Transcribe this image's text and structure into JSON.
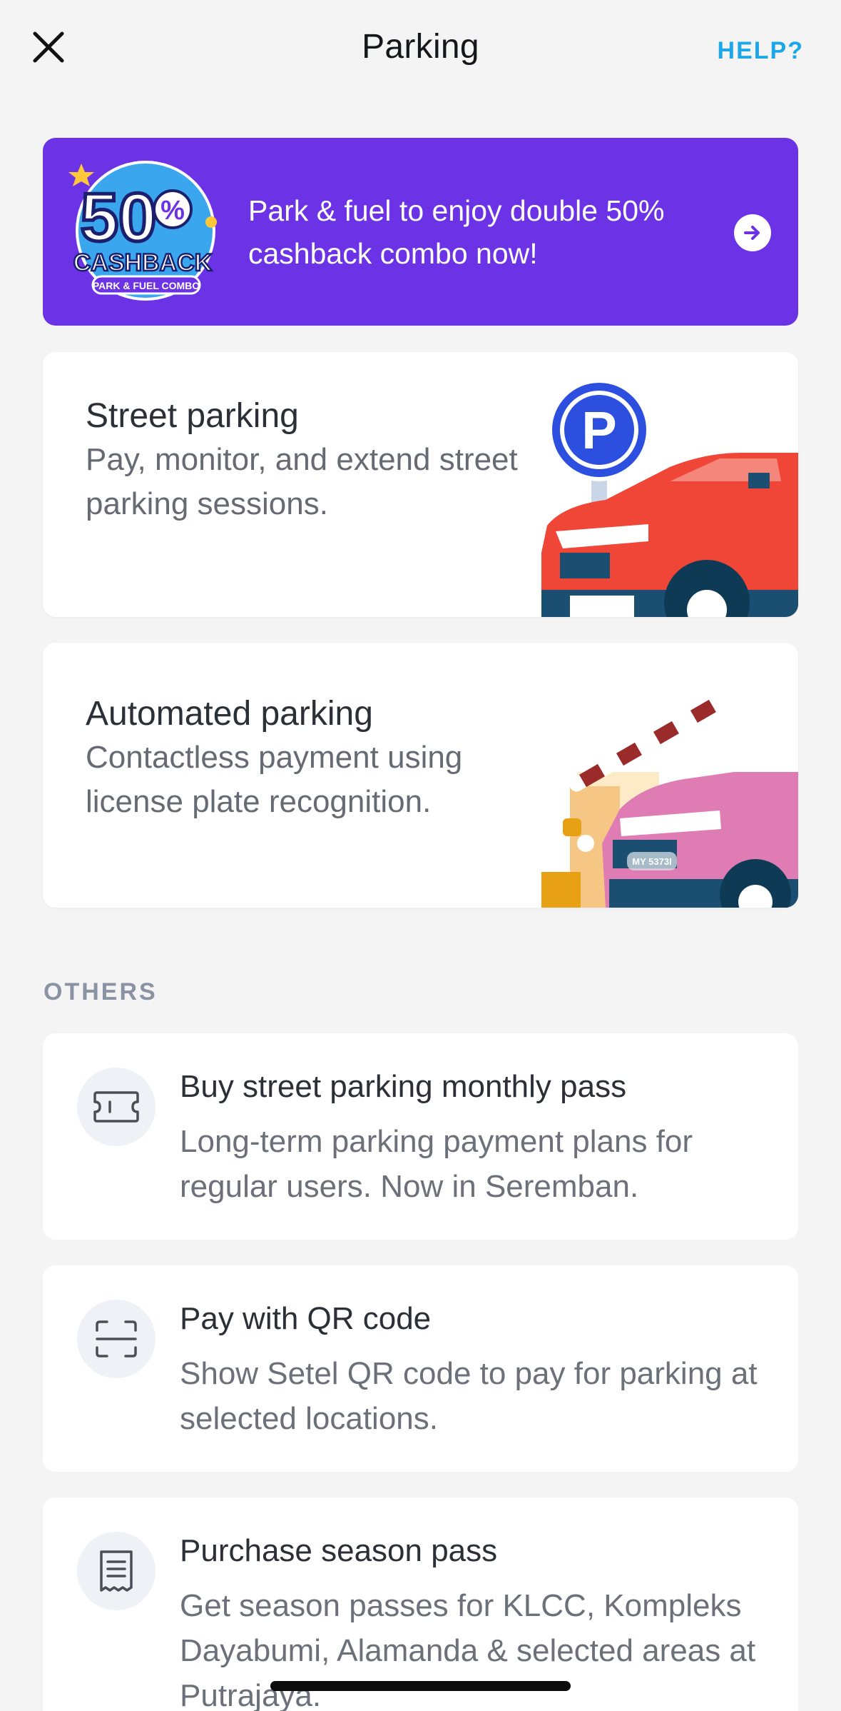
{
  "header": {
    "title": "Parking",
    "help_label": "HELP?",
    "close_icon": "close-icon"
  },
  "promo": {
    "badge_number": "50",
    "badge_percent": "%",
    "badge_word": "CASHBACK",
    "badge_ribbon": "PARK & FUEL COMBO",
    "text": "Park & fuel to enjoy double 50% cashback combo now!",
    "arrow_icon": "arrow-right-icon",
    "background_color": "#6c32e6"
  },
  "features": [
    {
      "title": "Street parking",
      "description": "Pay, monitor, and extend street parking sessions.",
      "sign_letter": "P"
    },
    {
      "title": "Automated parking",
      "description": "Contactless payment using license plate recognition.",
      "plate_text": "MY 5373I"
    }
  ],
  "others": {
    "section_label": "OTHERS",
    "items": [
      {
        "title": "Buy street parking monthly pass",
        "description": "Long-term parking payment plans for regular users. Now in Seremban.",
        "icon": "ticket-icon"
      },
      {
        "title": "Pay with QR code",
        "description": "Show Setel QR code to pay for parking at selected locations.",
        "icon": "scan-icon"
      },
      {
        "title": "Purchase season pass",
        "description": "Get season passes for KLCC, Kompleks Dayabumi, Alamanda & selected areas at Putrajaya.",
        "icon": "receipt-icon"
      }
    ]
  },
  "colors": {
    "accent": "#1ea7e8",
    "background": "#f4f4f5",
    "card": "#ffffff"
  }
}
